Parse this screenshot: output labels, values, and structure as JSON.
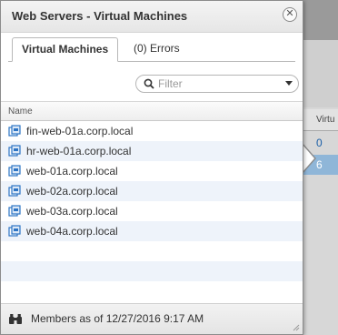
{
  "background": {
    "column_header": "Virtu",
    "cells": [
      "0",
      "6"
    ]
  },
  "popup": {
    "title": "Web Servers - Virtual Machines",
    "close_icon": "close-icon",
    "tabs": [
      {
        "label": "Virtual Machines",
        "active": true
      },
      {
        "label": "(0) Errors",
        "active": false
      }
    ],
    "filter": {
      "placeholder": "Filter",
      "icon": "search-icon"
    },
    "grid": {
      "column_header": "Name",
      "rows": [
        {
          "name": "fin-web-01a.corp.local",
          "icon": "vm-icon"
        },
        {
          "name": "hr-web-01a.corp.local",
          "icon": "vm-icon"
        },
        {
          "name": "web-01a.corp.local",
          "icon": "vm-icon"
        },
        {
          "name": "web-02a.corp.local",
          "icon": "vm-icon"
        },
        {
          "name": "web-03a.corp.local",
          "icon": "vm-icon"
        },
        {
          "name": "web-04a.corp.local",
          "icon": "vm-icon"
        }
      ]
    },
    "status": {
      "text": "Members as of 12/27/2016 9:17 AM",
      "icon": "binoculars-icon"
    }
  },
  "colors": {
    "selected_row": "#8fb6d8",
    "link_blue": "#1a5fa8",
    "alt_row": "#eef3fa"
  }
}
